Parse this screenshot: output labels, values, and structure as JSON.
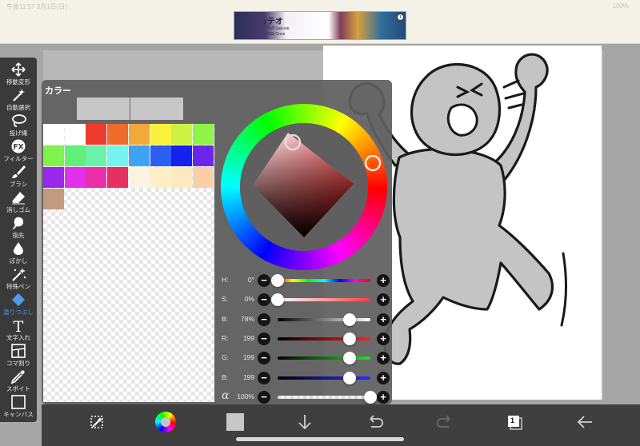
{
  "status": {
    "left_text": "午後11:57  3月1日(日)",
    "right_text": "100%"
  },
  "ad": {
    "title": "♪テオ",
    "line1": "作詞:Sakurai",
    "line2": "作曲:Omoi"
  },
  "toolbar": {
    "items": [
      {
        "label": "移動変形",
        "icon": "move-icon"
      },
      {
        "label": "自動選択",
        "icon": "magic-wand-icon"
      },
      {
        "label": "投げ縄",
        "icon": "lasso-icon"
      },
      {
        "label": "フィルター",
        "icon": "fx-icon"
      },
      {
        "label": "ブラシ",
        "icon": "brush-icon"
      },
      {
        "label": "消しゴム",
        "icon": "eraser-icon"
      },
      {
        "label": "指先",
        "icon": "smudge-icon"
      },
      {
        "label": "ぼかし",
        "icon": "blur-icon"
      },
      {
        "label": "特殊ペン",
        "icon": "special-pen-icon"
      },
      {
        "label": "塗りつぶし",
        "icon": "fill-icon",
        "active": true
      },
      {
        "label": "文字入れ",
        "icon": "text-icon"
      },
      {
        "label": "コマ割り",
        "icon": "frame-divider-icon"
      },
      {
        "label": "スポイト",
        "icon": "eyedropper-icon"
      },
      {
        "label": "キャンバス",
        "icon": "canvas-icon"
      }
    ]
  },
  "color_panel": {
    "title": "カラー",
    "current_color": "#c7c7c7",
    "palette": [
      "#ffffff",
      "#ffffff",
      "#ef3b2f",
      "#f06a2b",
      "#f3a83a",
      "#fdf03b",
      "#cdf241",
      "#8ef448",
      "#7ff34b",
      "#62f07a",
      "#6cf1ab",
      "#74f4ef",
      "#3fa3f3",
      "#2b5ff1",
      "#1620ef",
      "#6a26ec",
      "#9b27ea",
      "#e131ec",
      "#ea2fa8",
      "#e6305f",
      "#fdf3e3",
      "#fdeec6",
      "#fde9c0",
      "#f9cfa7",
      "#c29b7e"
    ],
    "hue_marker_color": "#c7c7c7",
    "sliders": [
      {
        "label": "H:",
        "value": "0°",
        "fraction": 0.0,
        "track": "hue"
      },
      {
        "label": "S:",
        "value": "0%",
        "fraction": 0.0,
        "track": "sat"
      },
      {
        "label": "B:",
        "value": "78%",
        "fraction": 0.78,
        "track": "bri"
      },
      {
        "label": "R:",
        "value": "199",
        "fraction": 0.78,
        "track": "red"
      },
      {
        "label": "G:",
        "value": "199",
        "fraction": 0.78,
        "track": "green"
      },
      {
        "label": "B:",
        "value": "199",
        "fraction": 0.78,
        "track": "blue"
      },
      {
        "label": "α",
        "value": "100%",
        "fraction": 1.0,
        "track": "alpha"
      }
    ]
  },
  "bottom_bar": {
    "items": [
      {
        "icon": "transform-select-icon"
      },
      {
        "icon": "color-wheel-icon"
      },
      {
        "icon": "current-color-square-icon"
      },
      {
        "icon": "download-arrow-icon"
      },
      {
        "icon": "undo-icon"
      },
      {
        "icon": "redo-icon"
      },
      {
        "icon": "layers-icon",
        "badge": "1"
      },
      {
        "icon": "back-arrow-icon"
      }
    ]
  }
}
